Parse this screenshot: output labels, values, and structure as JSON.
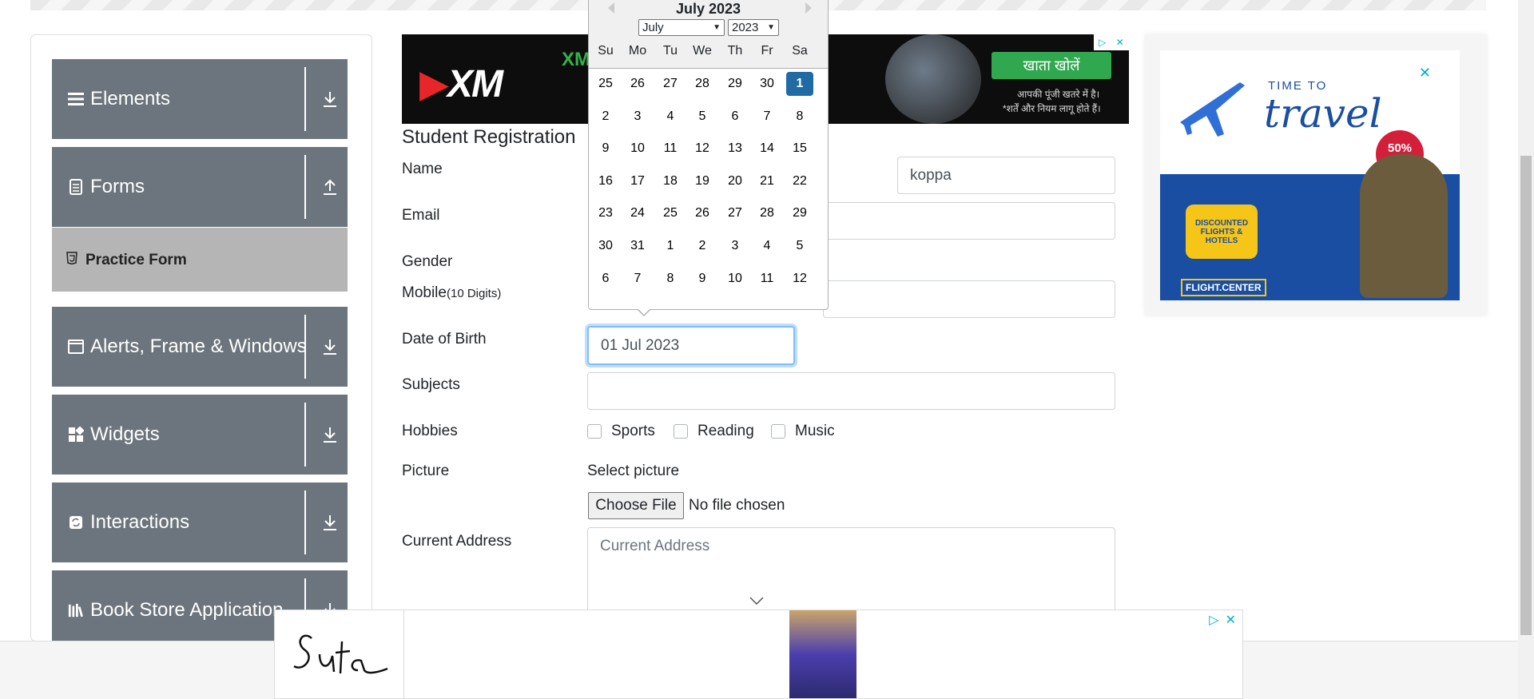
{
  "sidebar": {
    "groups": [
      {
        "label": "Elements",
        "icon": "hamburger-icon",
        "arrow": "download-arrow-icon"
      },
      {
        "label": "Forms",
        "icon": "document-icon",
        "arrow": "upload-arrow-icon"
      },
      {
        "label": "Alerts, Frame & Windows",
        "icon": "window-icon",
        "arrow": "download-arrow-icon"
      },
      {
        "label": "Widgets",
        "icon": "widgets-icon",
        "arrow": "download-arrow-icon"
      },
      {
        "label": "Interactions",
        "icon": "sync-icon",
        "arrow": "download-arrow-icon"
      },
      {
        "label": "Book Store Application",
        "icon": "books-icon",
        "arrow": "download-arrow-icon"
      }
    ],
    "active_item": {
      "label": "Practice Form",
      "icon": "html5-icon"
    }
  },
  "ads": {
    "top": {
      "brand": "XM",
      "cta": "खाता खोलें",
      "risk_line1": "आपकी पूंजी खतरे में है।",
      "risk_line2": "*शर्तें और नियम लागू होते हैं।"
    },
    "right": {
      "title_top": "TIME TO",
      "title_main": "travel",
      "badge": "50% OFF",
      "bubble": "DISCOUNTED FLIGHTS & HOTELS",
      "brand": "FLIGHT.CENTER"
    },
    "bottom": {
      "brand": "Suta"
    }
  },
  "form": {
    "title": "Student Registration",
    "labels": {
      "name": "Name",
      "email": "Email",
      "gender": "Gender",
      "mobile": "Mobile",
      "mobile_hint": "(10 Digits)",
      "dob": "Date of Birth",
      "subjects": "Subjects",
      "hobbies": "Hobbies",
      "picture": "Picture",
      "address": "Current Address"
    },
    "last_name_value": "koppa",
    "dob_value": "01 Jul 2023",
    "hobbies": [
      "Sports",
      "Reading",
      "Music"
    ],
    "select_picture": "Select picture",
    "choose_file": "Choose File",
    "no_file": "No file chosen",
    "address_placeholder": "Current Address"
  },
  "datepicker": {
    "header": "July 2023",
    "month_select": "July",
    "year_select": "2023",
    "day_names": [
      "Su",
      "Mo",
      "Tu",
      "We",
      "Th",
      "Fr",
      "Sa"
    ],
    "weeks": [
      [
        "25",
        "26",
        "27",
        "28",
        "29",
        "30",
        "1"
      ],
      [
        "2",
        "3",
        "4",
        "5",
        "6",
        "7",
        "8"
      ],
      [
        "9",
        "10",
        "11",
        "12",
        "13",
        "14",
        "15"
      ],
      [
        "16",
        "17",
        "18",
        "19",
        "20",
        "21",
        "22"
      ],
      [
        "23",
        "24",
        "25",
        "26",
        "27",
        "28",
        "29"
      ],
      [
        "30",
        "31",
        "1",
        "2",
        "3",
        "4",
        "5"
      ],
      [
        "6",
        "7",
        "8",
        "9",
        "10",
        "11",
        "12"
      ]
    ],
    "selected_day": "1"
  }
}
